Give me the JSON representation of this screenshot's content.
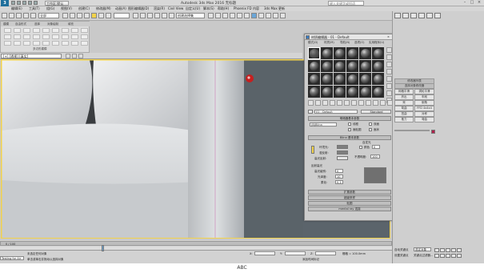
{
  "window": {
    "logo": "3",
    "workspace": "工作区:默认",
    "title": "Autodesk 3ds Max 2016     无标题",
    "search_placeholder": "键入关键字或短语"
  },
  "menubar": [
    "编辑(E)",
    "工具(T)",
    "组(G)",
    "视图(V)",
    "创建(C)",
    "修改器(M)",
    "动画(A)",
    "图形编辑器(D)",
    "渲染(R)",
    "Civil View",
    "自定义(U)",
    "脚本(S)",
    "帮助(H)",
    "Phoenix FD",
    "内容",
    "3ds Max 更新"
  ],
  "toolbar": {
    "filter_label": "全部",
    "selection_set": "创建选择集"
  },
  "ribbon": {
    "tabs": [
      "建模",
      "自由形式",
      "选择",
      "对象绘制",
      "填充"
    ],
    "sub_label": "多边形建模"
  },
  "viewport": {
    "label": "[+] [透视] [真实]",
    "selector": "默认"
  },
  "material_editor": {
    "title": "材质编辑器 - 01 - Default",
    "menus": [
      "模式(D)",
      "材质(M)",
      "导航(N)",
      "选项(O)",
      "实用程序(U)"
    ],
    "material_name": "01 - Default",
    "material_type": "Standard",
    "rollout_shader": "明暗器基本参数",
    "shader_type": "(B)Blinn",
    "opt_wire": "线框",
    "opt_2sided": "双面",
    "opt_facemap": "面贴图",
    "opt_faceted": "面状",
    "rollout_blinn": "Blinn 基本参数",
    "self_illum": "自发光",
    "ambient": "环境光:",
    "diffuse": "漫反射:",
    "specular": "高光反射:",
    "color_label": "颜色",
    "color_value": "0",
    "opacity_label": "不透明度:",
    "opacity_value": "100",
    "spec_group": "反射高光",
    "spec_level": "高光级别:",
    "spec_level_val": "0",
    "glossiness": "光泽度:",
    "glossiness_val": "10",
    "soften": "柔化:",
    "soften_val": "0.1",
    "extended": "扩展参数",
    "supersampling": "超级采样",
    "maps": "贴图",
    "mentalray": "mental ray 连接"
  },
  "rightpanel": {
    "modifier_list": "修改器列表",
    "buttons": [
      "网格平滑",
      "涡轮平滑",
      "挤出",
      "车削",
      "壳",
      "倒角",
      "弯曲",
      "FFD 4x4x4",
      "扭曲",
      "对称",
      "推力",
      "弯曲"
    ],
    "selection_group": "选择对象修改器"
  },
  "statusbar": {
    "status1": "未选定任何对象",
    "status2": "单击或单击并拖动以选择对象",
    "script_label": "Testing for Air",
    "frame": "0 / 100",
    "x_label": "X:",
    "y_label": "Y:",
    "z_label": "Z:",
    "grid": "栅格 = 100.0mm",
    "autokey": "自动关键点",
    "setkey": "设置关键点",
    "selected": "选定对象",
    "keyfilter": "关键点过滤器...",
    "add_time": "添加时间标记"
  },
  "caption": "ABC",
  "colors": {
    "viewport_border": "#f2d24a",
    "record": "#c62020"
  }
}
